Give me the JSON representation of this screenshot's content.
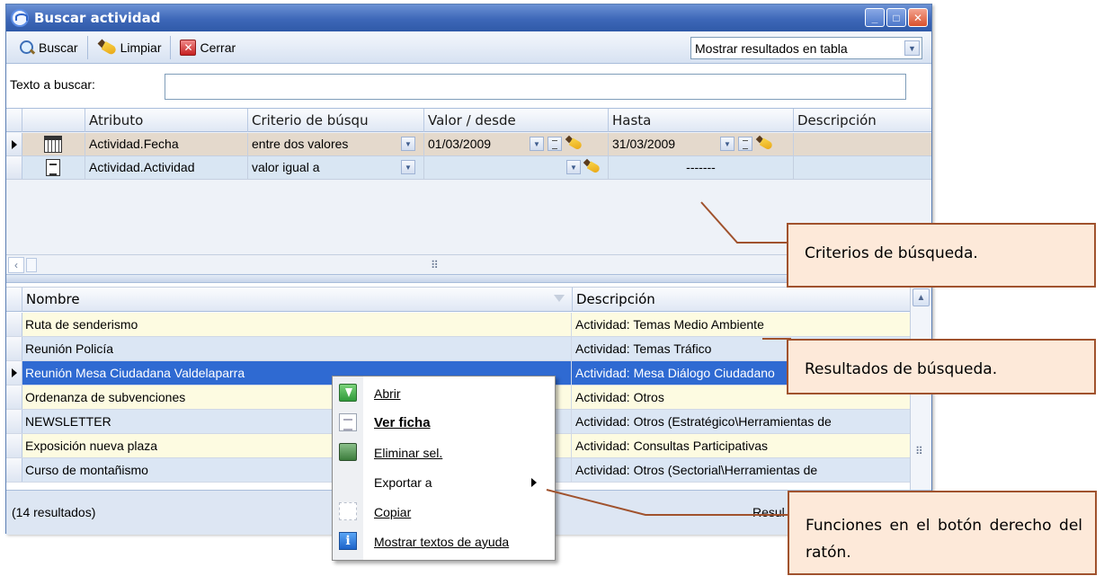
{
  "window": {
    "title": "Buscar actividad",
    "minimize_label": "_",
    "maximize_label": "□",
    "close_label": "✕"
  },
  "toolbar": {
    "buscar_label": "Buscar",
    "limpiar_label": "Limpiar",
    "cerrar_label": "Cerrar",
    "results_mode": "Mostrar resultados en tabla"
  },
  "search": {
    "label": "Texto a buscar:",
    "value": ""
  },
  "criteria": {
    "headers": [
      "Atributo",
      "Criterio de búsqu",
      "Valor / desde",
      "Hasta",
      "Descripción"
    ],
    "rows": [
      {
        "attribute": "Actividad.Fecha",
        "criterion": "entre dos valores",
        "from": "01/03/2009",
        "to": "31/03/2009",
        "description": ""
      },
      {
        "attribute": "Actividad.Actividad",
        "criterion": "valor igual a",
        "from": "",
        "to": "-------",
        "description": ""
      }
    ]
  },
  "results": {
    "headers": [
      "Nombre",
      "Descripción"
    ],
    "rows": [
      {
        "name": "Ruta de senderismo",
        "description": "Actividad: Temas Medio Ambiente"
      },
      {
        "name": "Reunión Policía",
        "description": "Actividad: Temas Tráfico"
      },
      {
        "name": "Reunión Mesa Ciudadana Valdelaparra",
        "description": "Actividad: Mesa Diálogo Ciudadano"
      },
      {
        "name": "Ordenanza de subvenciones",
        "description": "Actividad: Otros"
      },
      {
        "name": "NEWSLETTER",
        "description": "Actividad: Otros (Estratégico\\Herramientas de"
      },
      {
        "name": "Exposición nueva plaza",
        "description": "Actividad: Consultas Participativas"
      },
      {
        "name": "Curso de montañismo",
        "description": "Actividad: Otros (Sectorial\\Herramientas de"
      }
    ]
  },
  "status": {
    "count": "(14 resultados)",
    "right": "Resul"
  },
  "context_menu": {
    "items": [
      "Abrir",
      "Ver ficha",
      "Eliminar sel.",
      "Exportar a",
      "Copiar",
      "Mostrar textos de ayuda"
    ]
  },
  "callouts": {
    "criteria": "Criterios de búsqueda.",
    "results": "Resultados de búsqueda.",
    "functions": "Funciones en el botón derecho del ratón."
  },
  "colors": {
    "titlebar": "#3d67b8",
    "selection": "#2f6ad2",
    "callout_fill": "#fde9d9",
    "callout_border": "#a0522d"
  }
}
